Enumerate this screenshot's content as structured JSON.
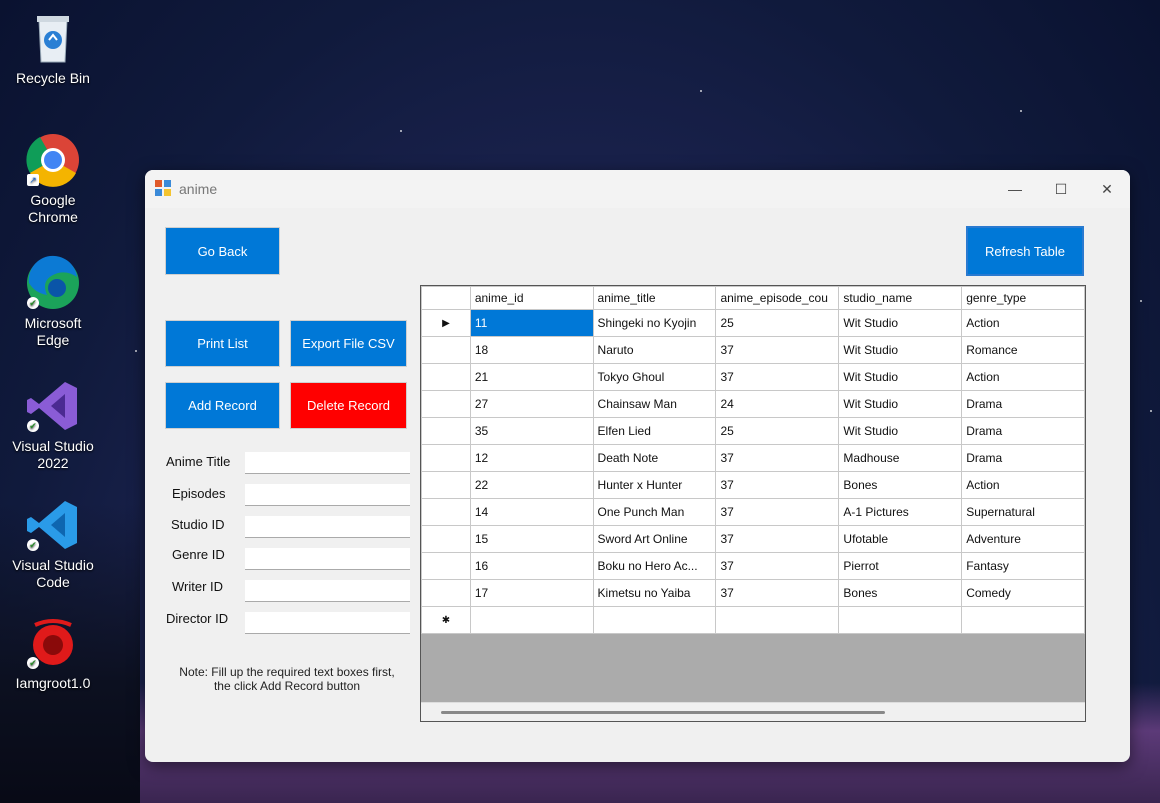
{
  "desktop": {
    "icons": [
      {
        "label": "Recycle Bin",
        "icon": "recycle-bin-icon"
      },
      {
        "label": "Google Chrome",
        "icon": "chrome-icon"
      },
      {
        "label": "Microsoft Edge",
        "icon": "edge-icon"
      },
      {
        "label": "Visual Studio 2022",
        "icon": "visual-studio-icon"
      },
      {
        "label": "Visual Studio Code",
        "icon": "vscode-icon"
      },
      {
        "label": "Iamgroot1.0",
        "icon": "app-icon"
      }
    ]
  },
  "window": {
    "title": "anime",
    "controls": {
      "minimize": "—",
      "maximize": "☐",
      "close": "✕"
    }
  },
  "buttons": {
    "go_back": "Go Back",
    "refresh_table": "Refresh Table",
    "print_list": "Print List",
    "export_csv": "Export File CSV",
    "add_record": "Add Record",
    "delete_record": "Delete Record"
  },
  "form": {
    "fields": [
      {
        "label": "Anime Title",
        "value": ""
      },
      {
        "label": "Episodes",
        "value": ""
      },
      {
        "label": "Studio ID",
        "value": ""
      },
      {
        "label": "Genre ID",
        "value": ""
      },
      {
        "label": "Writer ID",
        "value": ""
      },
      {
        "label": "Director ID",
        "value": ""
      }
    ],
    "note_line1": "Note: Fill up the required text boxes first,",
    "note_line2": "the click Add Record button"
  },
  "table": {
    "columns": [
      "anime_id",
      "anime_title",
      "anime_episode_cou",
      "studio_name",
      "genre_type"
    ],
    "rows": [
      [
        "11",
        "Shingeki no Kyojin",
        "25",
        "Wit Studio",
        "Action"
      ],
      [
        "18",
        "Naruto",
        "37",
        "Wit Studio",
        "Romance"
      ],
      [
        "21",
        "Tokyo Ghoul",
        "37",
        "Wit Studio",
        "Action"
      ],
      [
        "27",
        "Chainsaw Man",
        "24",
        "Wit Studio",
        "Drama"
      ],
      [
        "35",
        "Elfen Lied",
        "25",
        "Wit Studio",
        "Drama"
      ],
      [
        "12",
        "Death Note",
        "37",
        "Madhouse",
        "Drama"
      ],
      [
        "22",
        "Hunter x Hunter",
        "37",
        "Bones",
        "Action"
      ],
      [
        "14",
        "One Punch Man",
        "37",
        "A-1 Pictures",
        "Supernatural"
      ],
      [
        "15",
        "Sword Art Online",
        "37",
        "Ufotable",
        "Adventure"
      ],
      [
        "16",
        "Boku no Hero Ac...",
        "37",
        "Pierrot",
        "Fantasy"
      ],
      [
        "17",
        "Kimetsu no Yaiba",
        "37",
        "Bones",
        "Comedy"
      ]
    ],
    "current_row_marker": "▶",
    "new_row_marker": "✱"
  },
  "colors": {
    "accent": "#0078d7",
    "danger": "#ff0000"
  }
}
